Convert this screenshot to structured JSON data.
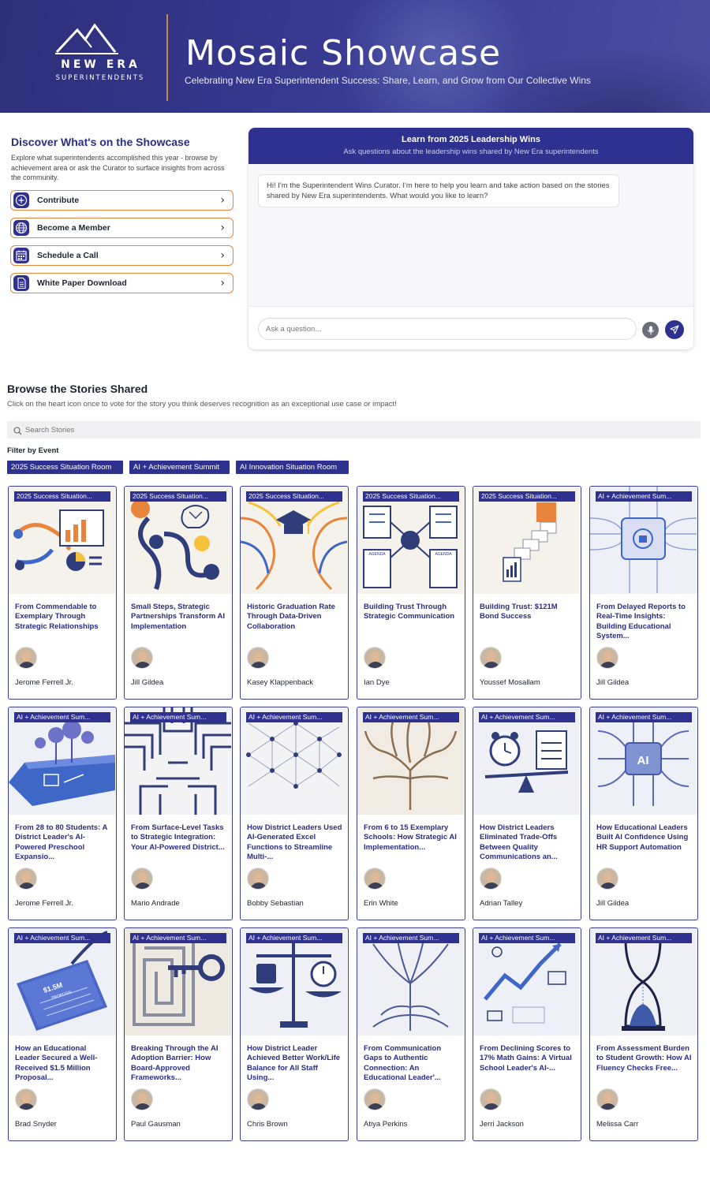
{
  "header": {
    "brand_line1": "NEW ERA",
    "brand_line2": "SUPERINTENDENTS",
    "title": "Mosaic Showcase",
    "subtitle": "Celebrating New Era Superintendent Success: Share, Learn, and Grow from Our Collective Wins"
  },
  "discover": {
    "title": "Discover What's on the Showcase",
    "description": "Explore what superintendents accomplished this year - browse by achievement area or ask the Curator to surface insights from across the community.",
    "actions": [
      {
        "label": "Contribute",
        "icon": "plus-circle-icon"
      },
      {
        "label": "Become a Member",
        "icon": "globe-icon"
      },
      {
        "label": "Schedule a Call",
        "icon": "calendar-icon"
      },
      {
        "label": "White Paper Download",
        "icon": "document-icon"
      }
    ]
  },
  "chat": {
    "title": "Learn from 2025 Leadership Wins",
    "subtitle": "Ask questions about the leadership wins shared by New Era superintendents",
    "greeting": "Hi! I'm the Superintendent Wins Curator. I'm here to help you learn and take action based on the stories shared by New Era superintendents. What would you like to learn?",
    "input_placeholder": "Ask a question..."
  },
  "browse": {
    "title": "Browse the Stories Shared",
    "description": "Click on the heart icon once to vote for the story you think deserves recognition as an exceptional use case or impact!",
    "search_placeholder": "Search Stories",
    "filter_label": "Filter by Event",
    "filters": [
      "2025 Success Situation Room",
      "AI + Achievement Summit",
      "AI Innovation Situation Room"
    ]
  },
  "colors": {
    "brand_navy": "#2f3190",
    "accent_orange": "#e8843b"
  },
  "stories": [
    {
      "tag": "2025 Success Situation...",
      "title": "From Commendable to Exemplary Through Strategic Relationships",
      "author": "Jerome Ferrell Jr."
    },
    {
      "tag": "2025 Success Situation...",
      "title": "Small Steps, Strategic Partnerships Transform AI Implementation",
      "author": "Jill Gildea"
    },
    {
      "tag": "2025 Success Situation...",
      "title": "Historic Graduation Rate Through Data-Driven Collaboration",
      "author": "Kasey Klappenback"
    },
    {
      "tag": "2025 Success Situation...",
      "title": "Building Trust Through Strategic Communication",
      "author": "Ian Dye"
    },
    {
      "tag": "2025 Success Situation...",
      "title": "Building Trust: $121M Bond Success",
      "author": "Youssef Mosallam"
    },
    {
      "tag": "AI + Achievement Sum...",
      "title": "From Delayed Reports to Real-Time Insights: Building Educational System...",
      "author": "Jill Gildea"
    },
    {
      "tag": "AI + Achievement Sum...",
      "title": "From 28 to 80 Students: A District Leader's AI-Powered Preschool Expansio...",
      "author": "Jerome Ferrell Jr."
    },
    {
      "tag": "AI + Achievement Sum...",
      "title": "From Surface-Level Tasks to Strategic Integration: Your AI-Powered District...",
      "author": "Mario Andrade"
    },
    {
      "tag": "AI + Achievement Sum...",
      "title": "How District Leaders Used AI-Generated Excel Functions to Streamline Multi-...",
      "author": "Bobby Sebastian"
    },
    {
      "tag": "AI + Achievement Sum...",
      "title": "From 6 to 15 Exemplary Schools: How Strategic AI Implementation...",
      "author": "Erin White"
    },
    {
      "tag": "AI + Achievement Sum...",
      "title": "How District Leaders Eliminated Trade-Offs Between Quality Communications an...",
      "author": "Adrian Talley"
    },
    {
      "tag": "AI + Achievement Sum...",
      "title": "How Educational Leaders Built AI Confidence Using HR Support Automation",
      "author": "Jill Gildea"
    },
    {
      "tag": "AI + Achievement Sum...",
      "title": "How an Educational Leader Secured a Well-Received $1.5 Million Proposal...",
      "author": "Brad Snyder"
    },
    {
      "tag": "AI + Achievement Sum...",
      "title": "Breaking Through the AI Adoption Barrier: How Board-Approved Frameworks...",
      "author": "Paul Gausman"
    },
    {
      "tag": "AI + Achievement Sum...",
      "title": "How District Leader Achieved Better Work/Life Balance for All Staff Using...",
      "author": "Chris Brown"
    },
    {
      "tag": "AI + Achievement Sum...",
      "title": "From Communication Gaps to Authentic Connection: An Educational Leader'...",
      "author": "Atiya Perkins"
    },
    {
      "tag": "AI + Achievement Sum...",
      "title": "From Declining Scores to 17% Math Gains: A Virtual School Leader's AI-...",
      "author": "Jerri Jackson"
    },
    {
      "tag": "AI + Achievement Sum...",
      "title": "From Assessment Burden to Student Growth: How AI Fluency Checks Free...",
      "author": "Melissa Carr"
    }
  ],
  "thumb_labels": {
    "agenda_1": "AGENDA",
    "agenda_2": "AGENDA",
    "proposal_amount": "$1.5M",
    "proposal_word": "PROPOSAL",
    "chip_label": "AI"
  }
}
